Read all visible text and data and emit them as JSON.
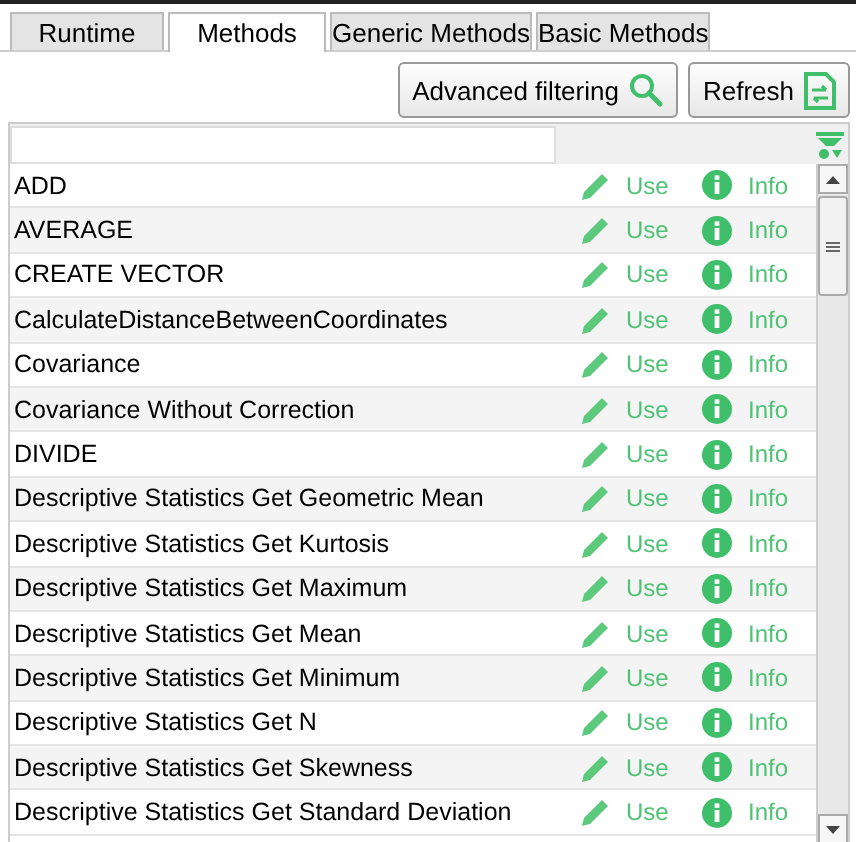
{
  "tabs": [
    {
      "label": "Runtime",
      "selected": false
    },
    {
      "label": "Methods",
      "selected": true
    },
    {
      "label": "Generic Methods",
      "selected": false
    },
    {
      "label": "Basic Methods",
      "selected": false
    }
  ],
  "buttons": [
    {
      "label": "Advanced filtering",
      "kind": "search"
    },
    {
      "label": "Refresh",
      "kind": "refresh"
    }
  ],
  "methods": [
    {
      "name": "ADD",
      "use": "Use",
      "info": "Info"
    },
    {
      "name": "AVERAGE",
      "use": "Use",
      "info": "Info"
    },
    {
      "name": "CREATE VECTOR",
      "use": "Use",
      "info": "Info"
    },
    {
      "name": "CalculateDistanceBetweenCoordinates",
      "use": "Use",
      "info": "Info"
    },
    {
      "name": "Covariance",
      "use": "Use",
      "info": "Info"
    },
    {
      "name": "Covariance Without Correction",
      "use": "Use",
      "info": "Info"
    },
    {
      "name": "DIVIDE",
      "use": "Use",
      "info": "Info"
    },
    {
      "name": "Descriptive Statistics Get Geometric Mean",
      "use": "Use",
      "info": "Info"
    },
    {
      "name": "Descriptive Statistics Get Kurtosis",
      "use": "Use",
      "info": "Info"
    },
    {
      "name": "Descriptive Statistics Get Maximum",
      "use": "Use",
      "info": "Info"
    },
    {
      "name": "Descriptive Statistics Get Mean",
      "use": "Use",
      "info": "Info"
    },
    {
      "name": "Descriptive Statistics Get Minimum",
      "use": "Use",
      "info": "Info"
    },
    {
      "name": "Descriptive Statistics Get N",
      "use": "Use",
      "info": "Info"
    },
    {
      "name": "Descriptive Statistics Get Skewness",
      "use": "Use",
      "info": "Info"
    },
    {
      "name": "Descriptive Statistics Get Standard Deviation",
      "use": "Use",
      "info": "Info"
    }
  ]
}
